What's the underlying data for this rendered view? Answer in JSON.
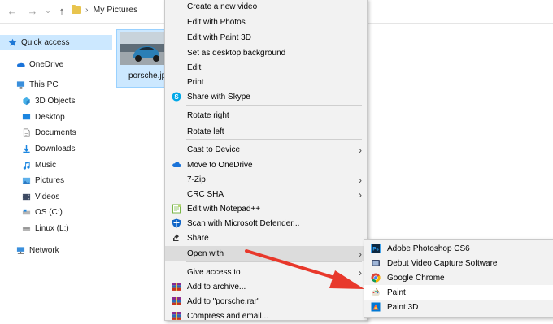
{
  "address": {
    "path": "My Pictures"
  },
  "sidebar": {
    "items": [
      {
        "label": "Quick access",
        "icon": "star-icon"
      },
      {
        "label": "OneDrive",
        "icon": "cloud-icon"
      },
      {
        "label": "This PC",
        "icon": "computer-icon"
      },
      {
        "label": "3D Objects",
        "icon": "cube-icon"
      },
      {
        "label": "Desktop",
        "icon": "desktop-icon"
      },
      {
        "label": "Documents",
        "icon": "document-icon"
      },
      {
        "label": "Downloads",
        "icon": "download-icon"
      },
      {
        "label": "Music",
        "icon": "music-icon"
      },
      {
        "label": "Pictures",
        "icon": "pictures-icon"
      },
      {
        "label": "Videos",
        "icon": "video-icon"
      },
      {
        "label": "OS (C:)",
        "icon": "drive-icon"
      },
      {
        "label": "Linux (L:)",
        "icon": "linux-drive-icon"
      },
      {
        "label": "Network",
        "icon": "network-icon"
      }
    ]
  },
  "file": {
    "name": "porsche.jp"
  },
  "context_menu": {
    "items": [
      {
        "label": "Create a new video"
      },
      {
        "label": "Edit with Photos"
      },
      {
        "label": "Edit with Paint 3D"
      },
      {
        "label": "Set as desktop background"
      },
      {
        "label": "Edit"
      },
      {
        "label": "Print"
      },
      {
        "label": "Share with Skype",
        "icon": "skype-icon"
      },
      {
        "label": "Rotate right"
      },
      {
        "label": "Rotate left"
      },
      {
        "label": "Cast to Device",
        "submenu": true
      },
      {
        "label": "Move to OneDrive",
        "icon": "onedrive-icon"
      },
      {
        "label": "7-Zip",
        "submenu": true
      },
      {
        "label": "CRC SHA",
        "submenu": true
      },
      {
        "label": "Edit with Notepad++",
        "icon": "notepadpp-icon"
      },
      {
        "label": "Scan with Microsoft Defender...",
        "icon": "defender-icon"
      },
      {
        "label": "Share",
        "icon": "share-icon"
      },
      {
        "label": "Open with",
        "submenu": true
      },
      {
        "label": "Give access to",
        "submenu": true
      },
      {
        "label": "Add to archive...",
        "icon": "winrar-icon"
      },
      {
        "label": "Add to \"porsche.rar\"",
        "icon": "winrar-icon"
      },
      {
        "label": "Compress and email...",
        "icon": "winrar-icon"
      }
    ]
  },
  "open_with_menu": {
    "items": [
      {
        "label": "Adobe Photoshop CS6",
        "icon": "photoshop-icon"
      },
      {
        "label": "Debut Video Capture Software",
        "icon": "debut-icon"
      },
      {
        "label": "Google Chrome",
        "icon": "chrome-icon"
      },
      {
        "label": "Paint",
        "icon": "paint-icon"
      },
      {
        "label": "Paint 3D",
        "icon": "paint3d-icon"
      }
    ]
  },
  "colors": {
    "annotation_arrow": "#e8382b",
    "selection": "#cce8ff",
    "menu_bg": "#f2f2f2"
  }
}
